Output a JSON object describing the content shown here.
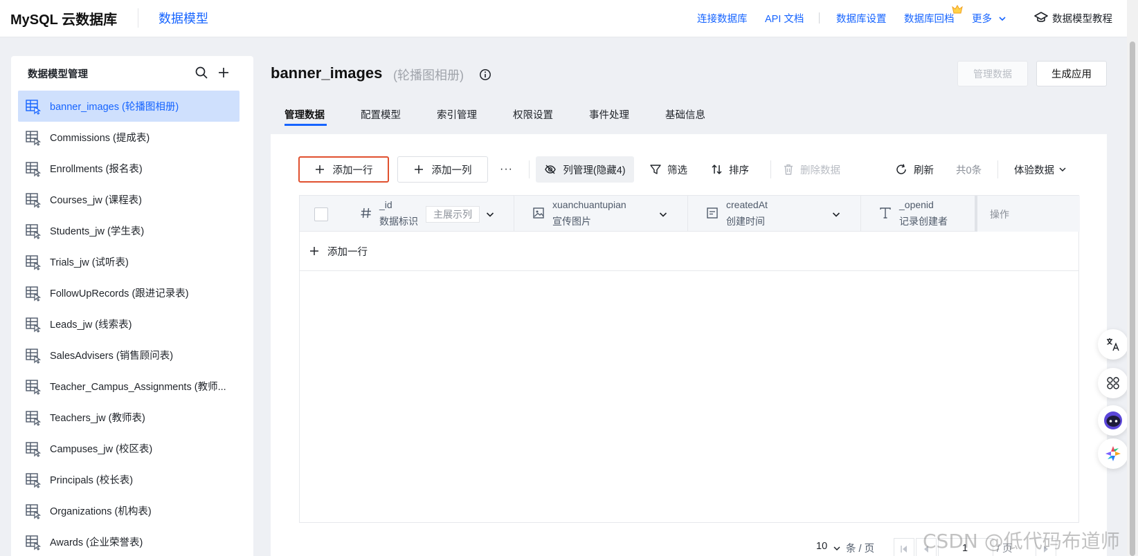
{
  "header": {
    "brand": "MySQL 云数据库",
    "product": "数据模型",
    "nav": [
      {
        "label": "连接数据库"
      },
      {
        "label": "API 文档"
      },
      {
        "label": "数据库设置"
      },
      {
        "label": "数据库回档"
      },
      {
        "label": "更多"
      }
    ],
    "tutorial": "数据模型教程"
  },
  "sidebar": {
    "title": "数据模型管理",
    "items": [
      {
        "label": "banner_images (轮播图相册)",
        "active": true
      },
      {
        "label": "Commissions (提成表)"
      },
      {
        "label": "Enrollments (报名表)"
      },
      {
        "label": "Courses_jw (课程表)"
      },
      {
        "label": "Students_jw (学生表)"
      },
      {
        "label": "Trials_jw (试听表)"
      },
      {
        "label": "FollowUpRecords (跟进记录表)"
      },
      {
        "label": "Leads_jw (线索表)"
      },
      {
        "label": "SalesAdvisers (销售顾问表)"
      },
      {
        "label": "Teacher_Campus_Assignments (教师..."
      },
      {
        "label": "Teachers_jw (教师表)"
      },
      {
        "label": "Campuses_jw (校区表)"
      },
      {
        "label": "Principals (校长表)"
      },
      {
        "label": "Organizations (机构表)"
      },
      {
        "label": "Awards (企业荣誉表)"
      }
    ]
  },
  "model": {
    "name": "banner_images",
    "display_name": "(轮播图相册)",
    "manage_button": "管理数据",
    "generate_button": "生成应用"
  },
  "tabs": [
    {
      "label": "管理数据",
      "active": true
    },
    {
      "label": "配置模型"
    },
    {
      "label": "索引管理"
    },
    {
      "label": "权限设置"
    },
    {
      "label": "事件处理"
    },
    {
      "label": "基础信息"
    }
  ],
  "toolbar": {
    "add_row": "添加一行",
    "add_column": "添加一列",
    "more": "···",
    "column_manage": "列管理(隐藏4)",
    "filter": "筛选",
    "sort": "排序",
    "delete": "删除数据",
    "refresh": "刷新",
    "count": "共0条",
    "trial_data": "体验数据"
  },
  "table": {
    "columns": [
      {
        "type_icon": "hash-icon",
        "name": "_id",
        "label": "数据标识",
        "badge": "主展示列"
      },
      {
        "type_icon": "image-icon",
        "name": "xuanchuantupian",
        "label": "宣传图片"
      },
      {
        "type_icon": "calendar-icon",
        "name": "createdAt",
        "label": "创建时间"
      },
      {
        "type_icon": "text-icon",
        "name": "_openid",
        "label": "记录创建者"
      }
    ],
    "operation_header": "操作",
    "add_row": "添加一行"
  },
  "pagination": {
    "page_size": "10",
    "page_size_unit": "条 / 页",
    "current_page": "1",
    "page_suffix": "/ 页"
  },
  "watermark": "CSDN @低代码布道师",
  "colors": {
    "accent": "#1664ff",
    "highlight_border": "#e0502e",
    "active_row": "#cfe0fd"
  }
}
